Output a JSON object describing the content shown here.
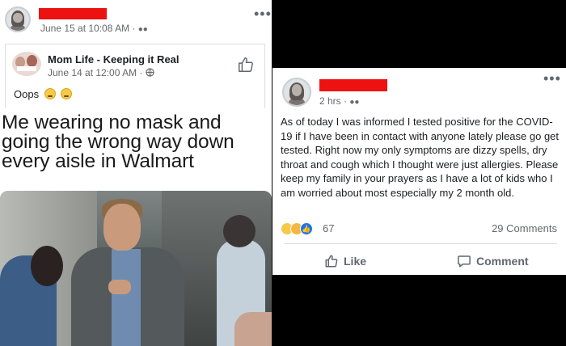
{
  "left_post": {
    "timestamp": "June 15 at 10:08 AM ·",
    "privacy_icon": "group-icon",
    "more_icon": "more-dots-icon",
    "shared": {
      "page_name": "Mom Life - Keeping it Real",
      "timestamp": "June 14 at 12:00 AM ·",
      "privacy_icon": "globe-icon",
      "like_icon": "thumbs-up-icon",
      "caption": "Oops",
      "caption_emojis": [
        "grimace-emoji",
        "flushed-emoji"
      ]
    },
    "meme_text": "Me wearing no mask and going the wrong way down every aisle in Walmart"
  },
  "right_post": {
    "timestamp": "2 hrs ·",
    "privacy_icon": "group-icon",
    "more_icon": "more-dots-icon",
    "body": "As of today I was informed I tested positive for the COVID-19 if I have been in contact with anyone lately please go get tested. Right now my only symptoms are dizzy spells, dry throat and cough which I thought were just allergies. Please keep my family in your prayers as I have a lot of kids who I am worried about most especially my 2 month old.",
    "reactions": [
      "sad-emoji",
      "wow-emoji",
      "like-emoji"
    ],
    "reaction_count": "67",
    "comments_label": "29 Comments",
    "like_label": "Like",
    "comment_label": "Comment"
  },
  "colors": {
    "redaction": "#ee1111",
    "facebook_blue": "#1877f2",
    "meta_gray": "#65676b"
  }
}
